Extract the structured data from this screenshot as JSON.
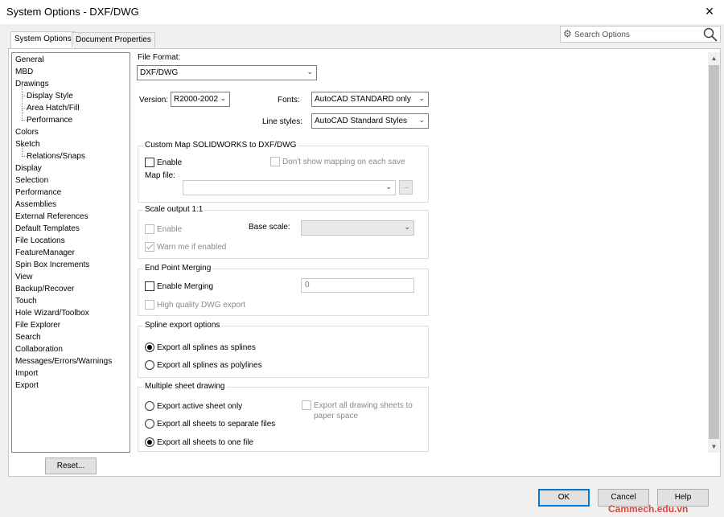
{
  "window": {
    "title": "System Options - DXF/DWG",
    "close_icon": "×"
  },
  "tabs": [
    {
      "label": "System Options",
      "active": true
    },
    {
      "label": "Document Properties",
      "active": false
    }
  ],
  "search": {
    "placeholder": "Search Options",
    "gear_icon": "gear-icon",
    "search_icon": "magnifier-icon"
  },
  "tree": [
    {
      "label": "General",
      "sub": false
    },
    {
      "label": "MBD",
      "sub": false
    },
    {
      "label": "Drawings",
      "sub": false
    },
    {
      "label": "Display Style",
      "sub": true
    },
    {
      "label": "Area Hatch/Fill",
      "sub": true
    },
    {
      "label": "Performance",
      "sub": true
    },
    {
      "label": "Colors",
      "sub": false
    },
    {
      "label": "Sketch",
      "sub": false
    },
    {
      "label": "Relations/Snaps",
      "sub": true
    },
    {
      "label": "Display",
      "sub": false
    },
    {
      "label": "Selection",
      "sub": false
    },
    {
      "label": "Performance",
      "sub": false
    },
    {
      "label": "Assemblies",
      "sub": false
    },
    {
      "label": "External References",
      "sub": false
    },
    {
      "label": "Default Templates",
      "sub": false
    },
    {
      "label": "File Locations",
      "sub": false
    },
    {
      "label": "FeatureManager",
      "sub": false
    },
    {
      "label": "Spin Box Increments",
      "sub": false
    },
    {
      "label": "View",
      "sub": false
    },
    {
      "label": "Backup/Recover",
      "sub": false
    },
    {
      "label": "Touch",
      "sub": false
    },
    {
      "label": "Hole Wizard/Toolbox",
      "sub": false
    },
    {
      "label": "File Explorer",
      "sub": false
    },
    {
      "label": "Search",
      "sub": false
    },
    {
      "label": "Collaboration",
      "sub": false
    },
    {
      "label": "Messages/Errors/Warnings",
      "sub": false
    },
    {
      "label": "Import",
      "sub": false
    },
    {
      "label": "Export",
      "sub": false
    }
  ],
  "reset_label": "Reset...",
  "file_format": {
    "label": "File Format:",
    "value": "DXF/DWG"
  },
  "version": {
    "label": "Version:",
    "value": "R2000-2002"
  },
  "fonts": {
    "label": "Fonts:",
    "value": "AutoCAD STANDARD only"
  },
  "line_styles": {
    "label": "Line styles:",
    "value": "AutoCAD Standard Styles"
  },
  "custom_map": {
    "title": "Custom Map SOLIDWORKS to DXF/DWG",
    "enable": "Enable",
    "dont_show": "Don't show mapping on each save",
    "map_file": "Map file:",
    "browse": "..."
  },
  "scale_output": {
    "title": "Scale output 1:1",
    "enable": "Enable",
    "base_scale": "Base scale:",
    "warn": "Warn me if enabled"
  },
  "end_point": {
    "title": "End Point Merging",
    "enable": "Enable Merging",
    "value": "0",
    "high_quality": "High quality DWG export"
  },
  "spline": {
    "title": "Spline export options",
    "opt1": "Export all splines as splines",
    "opt2": "Export all splines as polylines"
  },
  "multi_sheet": {
    "title": "Multiple sheet drawing",
    "opt1": "Export active sheet only",
    "opt2": "Export all sheets to separate files",
    "opt3": "Export all sheets to one file",
    "paper_line1": "Export all drawing sheets to",
    "paper_line2": "paper space"
  },
  "buttons": {
    "ok": "OK",
    "cancel": "Cancel",
    "help": "Help"
  },
  "watermark": "Cammech.edu.vn"
}
